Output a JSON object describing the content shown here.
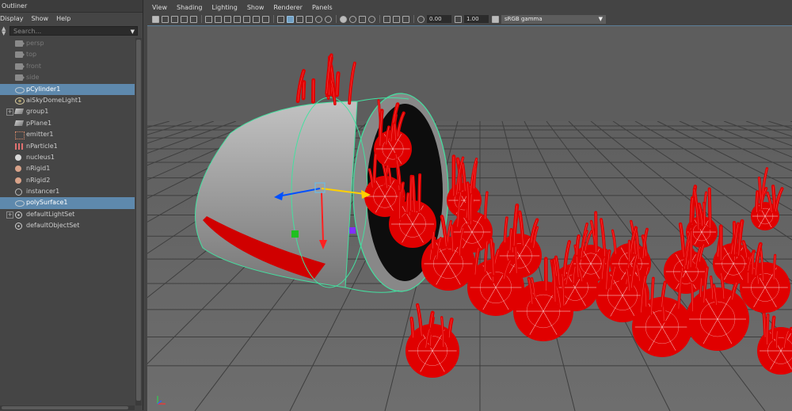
{
  "outliner": {
    "title": "Outliner",
    "menu": [
      "Display",
      "Show",
      "Help"
    ],
    "search_placeholder": "Search...",
    "items": [
      {
        "label": "persp",
        "icon": "camera-icon",
        "dim": true,
        "selected": false,
        "expander": ""
      },
      {
        "label": "top",
        "icon": "camera-icon",
        "dim": true,
        "selected": false,
        "expander": ""
      },
      {
        "label": "front",
        "icon": "camera-icon",
        "dim": true,
        "selected": false,
        "expander": ""
      },
      {
        "label": "side",
        "icon": "camera-icon",
        "dim": true,
        "selected": false,
        "expander": ""
      },
      {
        "label": "pCylinder1",
        "icon": "mesh-icon",
        "dim": false,
        "selected": true,
        "expander": ""
      },
      {
        "label": "aiSkyDomeLight1",
        "icon": "skydome-light-icon",
        "dim": false,
        "selected": false,
        "expander": ""
      },
      {
        "label": "group1",
        "icon": "group-icon",
        "dim": false,
        "selected": false,
        "expander": "+"
      },
      {
        "label": "pPlane1",
        "icon": "plane-icon",
        "dim": false,
        "selected": false,
        "expander": ""
      },
      {
        "label": "emitter1",
        "icon": "emitter-icon",
        "dim": false,
        "selected": false,
        "expander": ""
      },
      {
        "label": "nParticle1",
        "icon": "nparticle-icon",
        "dim": false,
        "selected": false,
        "expander": ""
      },
      {
        "label": "nucleus1",
        "icon": "nucleus-icon",
        "dim": false,
        "selected": false,
        "expander": ""
      },
      {
        "label": "nRigid1",
        "icon": "nrigid-icon",
        "dim": false,
        "selected": false,
        "expander": ""
      },
      {
        "label": "nRigid2",
        "icon": "nrigid-icon",
        "dim": false,
        "selected": false,
        "expander": ""
      },
      {
        "label": "instancer1",
        "icon": "instancer-icon",
        "dim": false,
        "selected": false,
        "expander": ""
      },
      {
        "label": "polySurface1",
        "icon": "mesh-icon",
        "dim": false,
        "selected": true,
        "expander": ""
      },
      {
        "label": "defaultLightSet",
        "icon": "set-icon",
        "dim": false,
        "selected": false,
        "expander": "+"
      },
      {
        "label": "defaultObjectSet",
        "icon": "set-icon",
        "dim": false,
        "selected": false,
        "expander": ""
      }
    ]
  },
  "viewport": {
    "menu": [
      "View",
      "Shading",
      "Lighting",
      "Show",
      "Renderer",
      "Panels"
    ],
    "exposure": "0.00",
    "gamma_value": "1.00",
    "color_space": "sRGB gamma",
    "selection_color": "#5e89ad",
    "mesh_color": "#e00000",
    "wire_color": "#ffffff",
    "highlight_color": "#44e0a0"
  }
}
